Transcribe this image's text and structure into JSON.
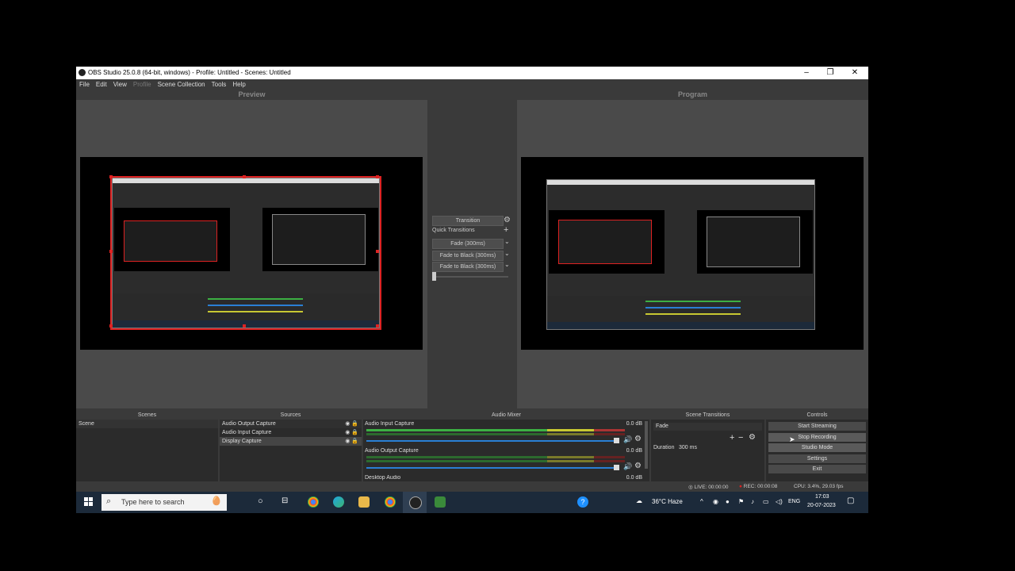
{
  "window": {
    "title": "OBS Studio 25.0.8 (64-bit, windows) - Profile: Untitled - Scenes: Untitled",
    "controls": [
      "–",
      "❐",
      "✕"
    ]
  },
  "menu": [
    "File",
    "Edit",
    "View",
    "Profile",
    "Scene Collection",
    "Tools",
    "Help"
  ],
  "preview_label": "Preview",
  "program_label": "Program",
  "transition": {
    "label": "Transition",
    "quick_label": "Quick Transitions",
    "buttons": [
      "Fade (300ms)",
      "Fade to Black (300ms)",
      "Fade to Black (300ms)"
    ]
  },
  "docks": {
    "scenes": {
      "title": "Scenes",
      "items": [
        "Scene"
      ]
    },
    "sources": {
      "title": "Sources",
      "items": [
        "Audio Output Capture",
        "Audio Input Capture",
        "Display Capture"
      ]
    },
    "mixer": {
      "title": "Audio Mixer",
      "channels": [
        {
          "name": "Audio Input Capture",
          "db": "0.0 dB",
          "level": 0.95
        },
        {
          "name": "Audio Output Capture",
          "db": "0.0 dB",
          "level": 0.95
        },
        {
          "name": "Desktop Audio",
          "db": "0.0 dB",
          "level": 0.95
        }
      ]
    },
    "transitions": {
      "title": "Scene Transitions",
      "selected": "Fade",
      "duration_label": "Duration",
      "duration_value": "300 ms"
    },
    "controls": {
      "title": "Controls",
      "buttons": [
        "Start Streaming",
        "Stop Recording",
        "Studio Mode",
        "Settings",
        "Exit"
      ]
    }
  },
  "status": {
    "live": "LIVE: 00:00:00",
    "rec": "REC: 00:00:08",
    "cpu": "CPU: 3.4%, 29.03 fps"
  },
  "taskbar": {
    "search_placeholder": "Type here to search",
    "weather": "36°C  Haze",
    "lang": "ENG",
    "time": "17:03",
    "date": "20-07-2023"
  },
  "colors": {
    "accent_red": "#dd2222",
    "meter_green": "#3cb043",
    "meter_yellow": "#c8c832",
    "volume_blue": "#2a7fd4"
  }
}
